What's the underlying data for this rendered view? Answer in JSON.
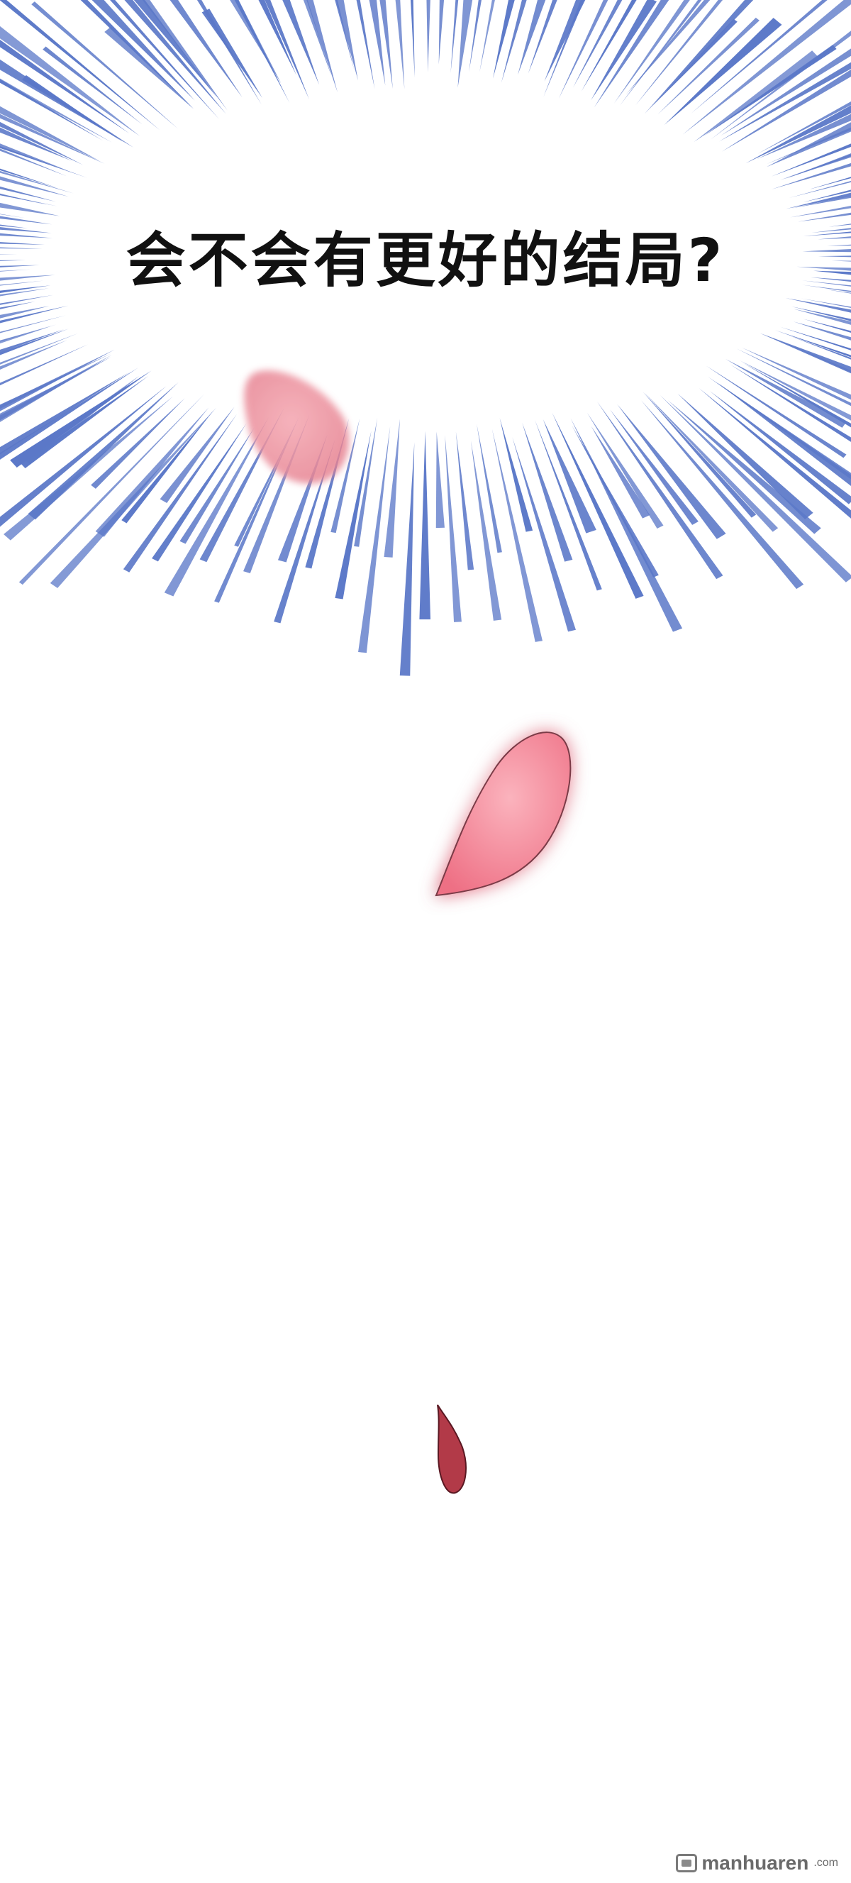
{
  "caption": "会不会有更好的结局?",
  "watermark": {
    "name": "manhuaren",
    "tld": ".com"
  },
  "colors": {
    "burst": "#5b78c8",
    "petal_pink": "#f28a99",
    "petal_dark": "#b23a48",
    "background": "#ffffff"
  }
}
